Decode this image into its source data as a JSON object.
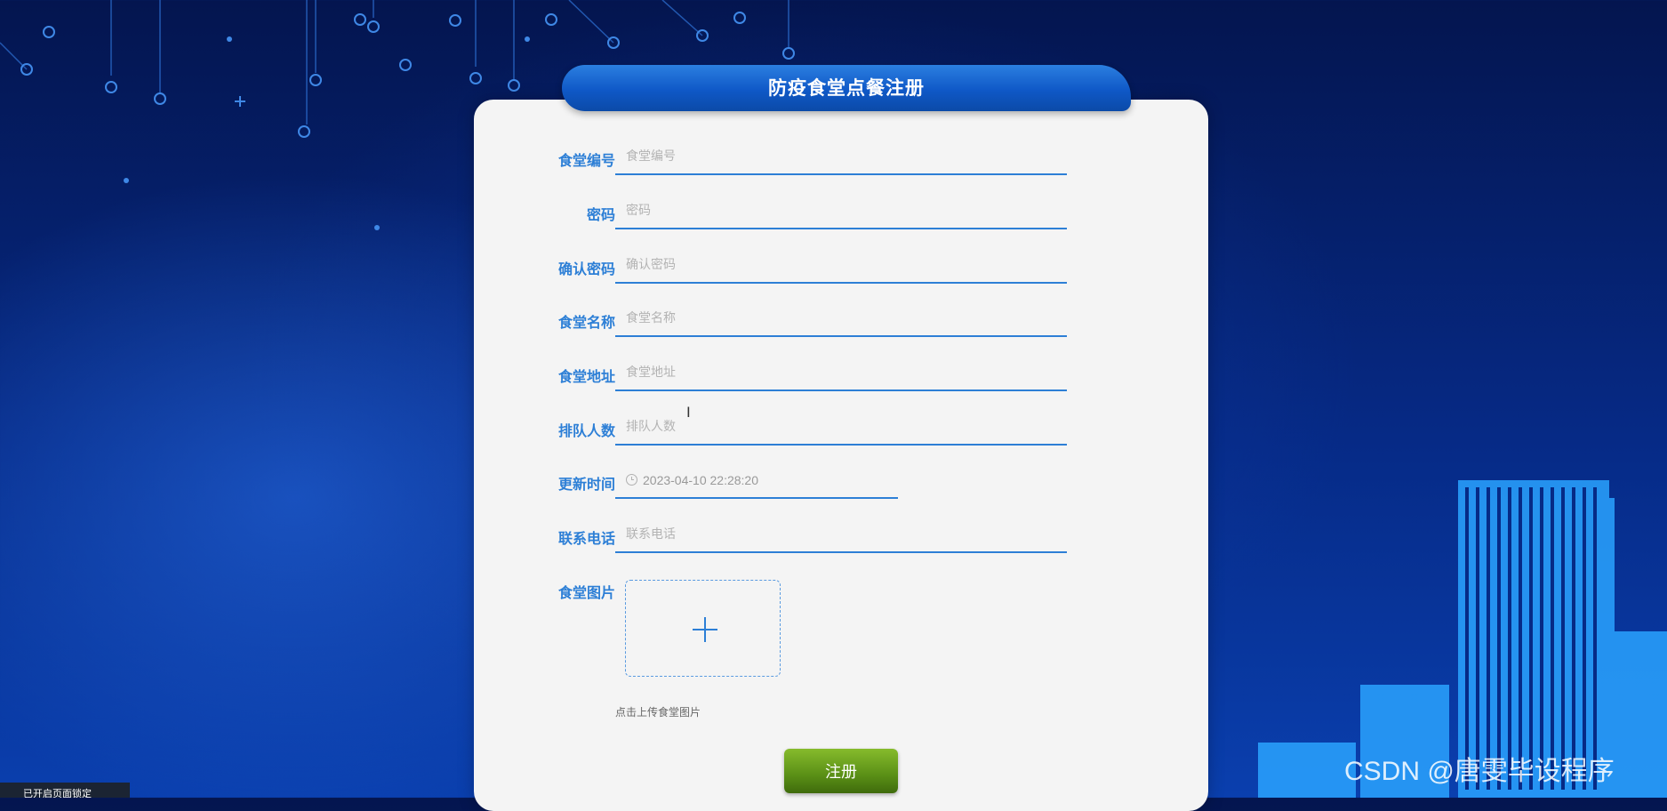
{
  "page": {
    "title": "防疫食堂点餐注册"
  },
  "form": {
    "fields": [
      {
        "label": "食堂编号",
        "placeholder": "食堂编号",
        "value": ""
      },
      {
        "label": "密码",
        "placeholder": "密码",
        "value": ""
      },
      {
        "label": "确认密码",
        "placeholder": "确认密码",
        "value": ""
      },
      {
        "label": "食堂名称",
        "placeholder": "食堂名称",
        "value": ""
      },
      {
        "label": "食堂地址",
        "placeholder": "食堂地址",
        "value": ""
      },
      {
        "label": "排队人数",
        "placeholder": "排队人数",
        "value": ""
      },
      {
        "label": "更新时间",
        "placeholder": "",
        "value": "2023-04-10 22:28:20"
      },
      {
        "label": "联系电话",
        "placeholder": "联系电话",
        "value": ""
      }
    ],
    "image_label": "食堂图片",
    "upload_hint": "点击上传食堂图片",
    "submit_label": "注册"
  },
  "watermark": "CSDN @唐雯毕设程序",
  "status_chip": "已开启页面锁定",
  "colors": {
    "accent": "#2d7fd6",
    "submit": "#5a8f16",
    "title_bar": "#1565d2"
  }
}
